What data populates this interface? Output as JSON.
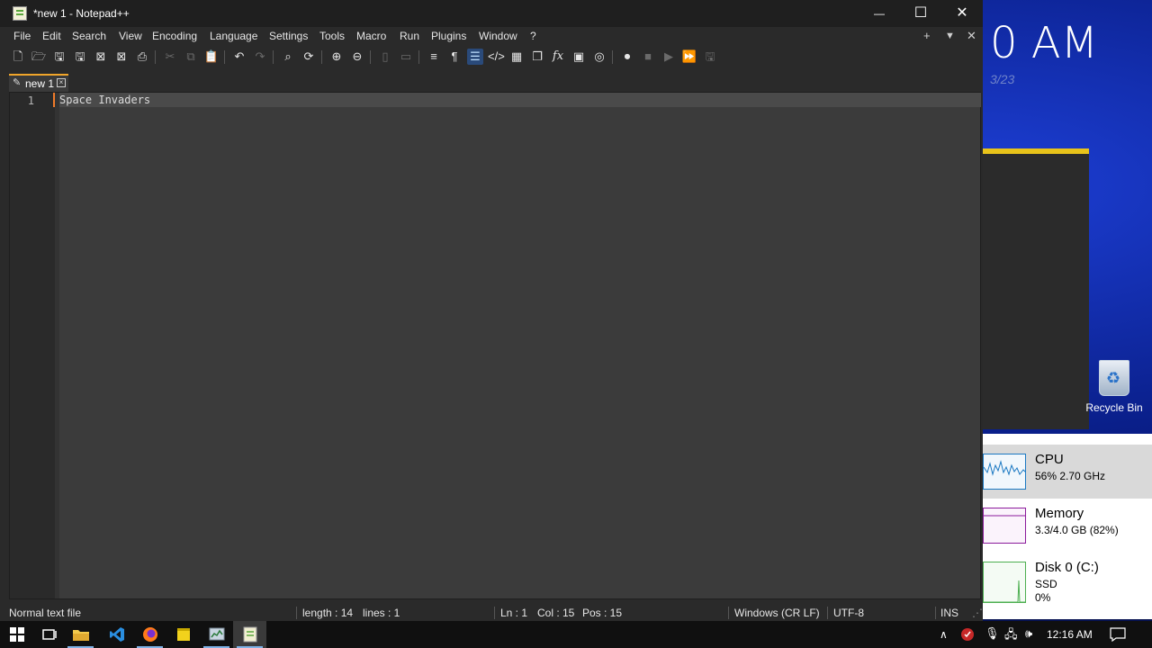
{
  "desktop": {
    "clock_text": "0 AM",
    "date_text": "3/23",
    "recycle_bin_label": "Recycle Bin"
  },
  "taskmgr": {
    "rows": [
      {
        "title": "CPU",
        "sub1": "56% 2.70 GHz",
        "sub2": ""
      },
      {
        "title": "Memory",
        "sub1": "3.3/4.0 GB (82%)",
        "sub2": ""
      },
      {
        "title": "Disk 0 (C:)",
        "sub1": "SSD",
        "sub2": "0%"
      }
    ]
  },
  "window": {
    "title": "*new 1 - Notepad++",
    "minimize_glyph": "—",
    "maximize_glyph": "☐",
    "close_glyph": "✕"
  },
  "menu": {
    "items": [
      "File",
      "Edit",
      "Search",
      "View",
      "Encoding",
      "Language",
      "Settings",
      "Tools",
      "Macro",
      "Run",
      "Plugins",
      "Window",
      "?"
    ],
    "right": [
      "+",
      "▼",
      "✕"
    ]
  },
  "toolbar": {
    "icons": [
      "new-file-icon",
      "open-file-icon",
      "save-icon",
      "save-all-icon",
      "close-icon",
      "close-all-icon",
      "print-icon",
      "cut-icon",
      "copy-icon",
      "paste-icon",
      "undo-icon",
      "redo-icon",
      "find-icon",
      "replace-icon",
      "zoom-in-icon",
      "zoom-out-icon",
      "sync-v-icon",
      "sync-h-icon",
      "word-wrap-icon",
      "show-all-chars-icon",
      "indent-guide-icon",
      "xml-tag-icon",
      "document-map-icon",
      "document-list-icon",
      "function-list-icon",
      "folder-workspace-icon",
      "monitoring-icon",
      "record-macro-icon",
      "stop-macro-icon",
      "play-macro-icon",
      "run-multiple-macro-icon",
      "save-macro-icon"
    ]
  },
  "tab": {
    "label": "new 1",
    "close_glyph": "×"
  },
  "editor": {
    "line_number": "1",
    "content": "Space Invaders"
  },
  "status": {
    "file_type": "Normal text file",
    "length": "length : 14",
    "lines": "lines : 1",
    "ln": "Ln : 1",
    "col": "Col : 15",
    "pos": "Pos : 15",
    "eol": "Windows (CR LF)",
    "encoding": "UTF-8",
    "mode": "INS"
  },
  "taskbar": {
    "time": "12:16 AM"
  },
  "colors": {
    "tab_accent": "#f0a52a",
    "cpu_graph": "#1a78c2",
    "memory_graph": "#8b1a9b",
    "disk_graph": "#4caf50",
    "panel_accent": "#e8c31a"
  }
}
